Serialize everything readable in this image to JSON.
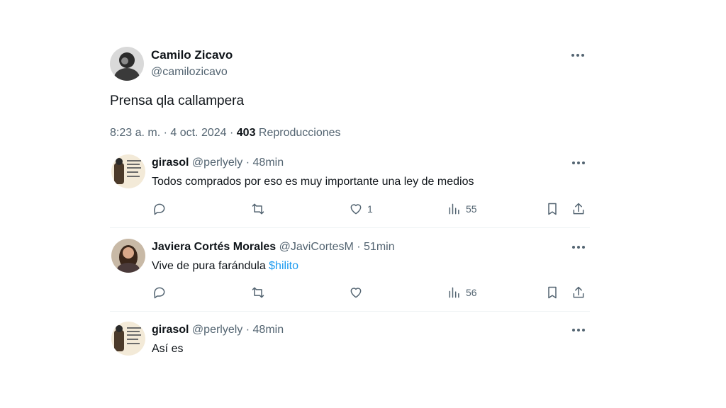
{
  "tweet": {
    "author_name": "Camilo Zicavo",
    "author_handle": "@camilozicavo",
    "text": "Prensa qla callampera",
    "time": "8:23 a. m. · 4 oct. 2024 · ",
    "views_count": "403",
    "views_label": "Reproducciones"
  },
  "replies": [
    {
      "name": "girasol",
      "meta": "@perlyely · 48min",
      "text": "Todos comprados por eso es muy importante una ley de medios",
      "likes": "1",
      "views": "55"
    },
    {
      "name": "Javiera Cortés Morales",
      "meta": "@JaviCortesM · 51min",
      "text": "Vive de pura farándula ",
      "link": "$hilito",
      "views": "56"
    },
    {
      "name": "girasol",
      "meta": "@perlyely · 48min",
      "text": "Así es"
    }
  ],
  "icons": {
    "more": "more-horizontal-icon",
    "reply": "reply-icon",
    "retweet": "retweet-icon",
    "like": "heart-icon",
    "views": "analytics-icon",
    "bookmark": "bookmark-icon",
    "share": "share-icon"
  },
  "colors": {
    "text": "#0f1419",
    "secondary": "#536471",
    "link": "#1d9bf0",
    "divider": "#eff3f4"
  }
}
